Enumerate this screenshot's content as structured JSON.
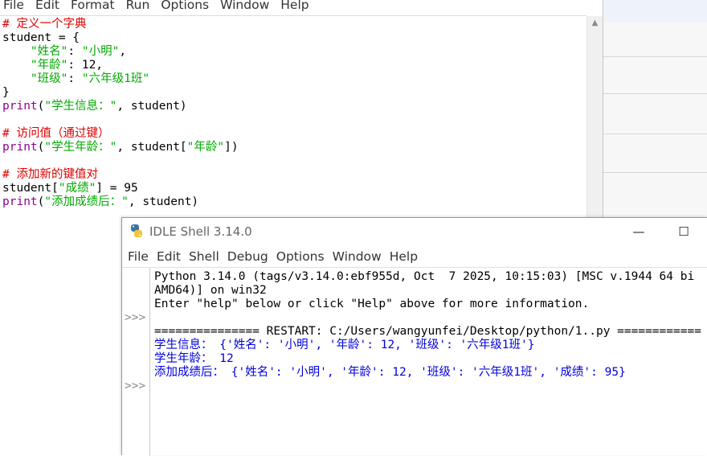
{
  "editor": {
    "menu": [
      "File",
      "Edit",
      "Format",
      "Run",
      "Options",
      "Window",
      "Help"
    ],
    "code": {
      "l1": "# 定义一个字典",
      "l2": "student = {",
      "l3_pad": "    ",
      "l3_key": "\"姓名\"",
      "l3_sep": ": ",
      "l3_val": "\"小明\"",
      "l3_end": ",",
      "l4_pad": "    ",
      "l4_key": "\"年龄\"",
      "l4_rest": ": 12,",
      "l5_pad": "    ",
      "l5_key": "\"班级\"",
      "l5_sep": ": ",
      "l5_val": "\"六年级1班\"",
      "l6": "}",
      "l7_fn": "print",
      "l7_open": "(",
      "l7_str": "\"学生信息：\"",
      "l7_rest": ", student)",
      "l9": "# 访问值（通过键）",
      "l10_fn": "print",
      "l10_open": "(",
      "l10_str": "\"学生年龄：\"",
      "l10_mid": ", student[",
      "l10_key": "\"年龄\"",
      "l10_end": "])",
      "l12": "# 添加新的键值对",
      "l13_a": "student[",
      "l13_key": "\"成绩\"",
      "l13_b": "] = 95",
      "l14_fn": "print",
      "l14_open": "(",
      "l14_str": "\"添加成绩后：\"",
      "l14_rest": ", student)"
    }
  },
  "shell": {
    "title": "IDLE Shell 3.14.0",
    "minimize": "—",
    "maximize": "☐",
    "menu": [
      "File",
      "Edit",
      "Shell",
      "Debug",
      "Options",
      "Window",
      "Help"
    ],
    "prompt": ">>>",
    "banner1": "Python 3.14.0 (tags/v3.14.0:ebf955d, Oct  7 2025, 10:15:03) [MSC v.1944 64 bi",
    "banner2": "AMD64)] on win32",
    "banner3": "Enter \"help\" below or click \"Help\" above for more information.",
    "restart": "=============== RESTART: C:/Users/wangyunfei/Desktop/python/1..py ============",
    "out1": "学生信息： {'姓名': '小明', '年龄': 12, '班级': '六年级1班'}",
    "out2": "学生年龄： 12",
    "out3": "添加成绩后： {'姓名': '小明', '年龄': 12, '班级': '六年级1班', '成绩': 95}"
  },
  "colors": {
    "comment": "#dd0000",
    "string": "#00aa00",
    "builtin": "#900090",
    "output": "#0000dd",
    "prompt": "#8a8a8a"
  }
}
